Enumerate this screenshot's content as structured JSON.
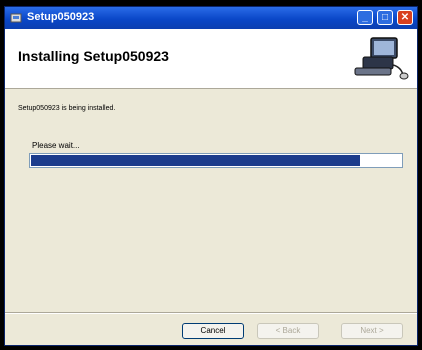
{
  "window": {
    "title": "Setup050923"
  },
  "header": {
    "title": "Installing Setup050923"
  },
  "main": {
    "status_text": "Setup050923 is being installed.",
    "wait_label": "Please wait...",
    "progress": 0.89
  },
  "buttons": {
    "cancel": "Cancel",
    "back": "< Back",
    "next": "Next >"
  },
  "icons": [
    "installer-icon",
    "minimize-icon",
    "maximize-icon",
    "close-icon",
    "computer-logo-icon"
  ],
  "colors": {
    "titlebar": "#0a47c8",
    "progress_fill": "#1c3c8c",
    "close_button": "#d8401f"
  }
}
